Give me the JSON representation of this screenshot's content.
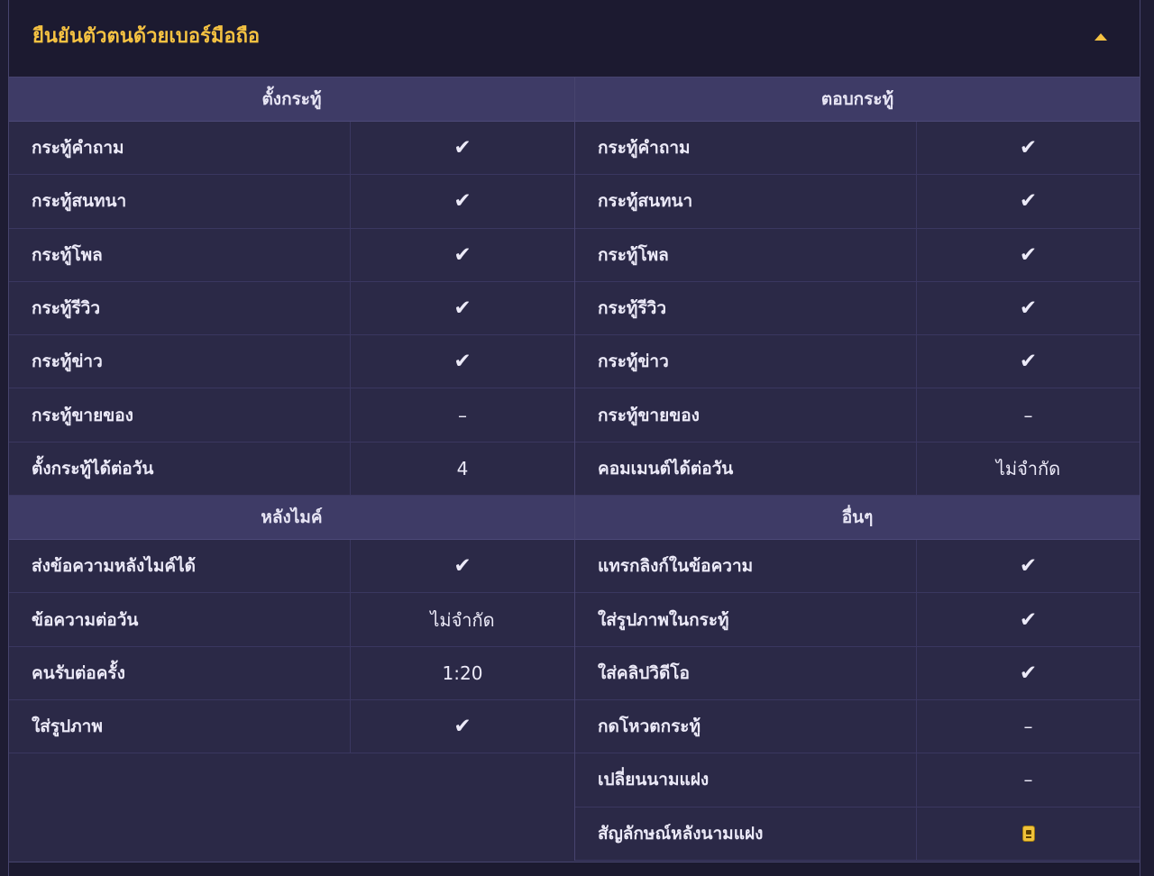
{
  "header": {
    "title": "ยืนยันตัวตนด้วยเบอร์มือถือ",
    "collapse_icon": "chevron-up-icon"
  },
  "colors": {
    "accent": "#f5c242",
    "panel_bg": "#2b2947",
    "section_header_bg": "#3e3b66"
  },
  "left": {
    "sections": [
      {
        "title": "ตั้งกระทู้",
        "rows": [
          {
            "label": "กระทู้คำถาม",
            "value": "✔"
          },
          {
            "label": "กระทู้สนทนา",
            "value": "✔"
          },
          {
            "label": "กระทู้โพล",
            "value": "✔"
          },
          {
            "label": "กระทู้รีวิว",
            "value": "✔"
          },
          {
            "label": "กระทู้ข่าว",
            "value": "✔"
          },
          {
            "label": "กระทู้ขายของ",
            "value": "–"
          },
          {
            "label": "ตั้งกระทู้ได้ต่อวัน",
            "value": "4"
          }
        ]
      },
      {
        "title": "หลังไมค์",
        "rows": [
          {
            "label": "ส่งข้อความหลังไมค์ได้",
            "value": "✔"
          },
          {
            "label": "ข้อความต่อวัน",
            "value": "ไม่จำกัด"
          },
          {
            "label": "คนรับต่อครั้ง",
            "value": "1:20"
          },
          {
            "label": "ใส่รูปภาพ",
            "value": "✔"
          }
        ]
      }
    ]
  },
  "right": {
    "sections": [
      {
        "title": "ตอบกระทู้",
        "rows": [
          {
            "label": "กระทู้คำถาม",
            "value": "✔"
          },
          {
            "label": "กระทู้สนทนา",
            "value": "✔"
          },
          {
            "label": "กระทู้โพล",
            "value": "✔"
          },
          {
            "label": "กระทู้รีวิว",
            "value": "✔"
          },
          {
            "label": "กระทู้ข่าว",
            "value": "✔"
          },
          {
            "label": "กระทู้ขายของ",
            "value": "–"
          },
          {
            "label": "คอมเมนต์ได้ต่อวัน",
            "value": "ไม่จำกัด"
          }
        ]
      },
      {
        "title": "อื่นๆ",
        "rows": [
          {
            "label": "แทรกลิงก์ในข้อความ",
            "value": "✔"
          },
          {
            "label": "ใส่รูปภาพในกระทู้",
            "value": "✔"
          },
          {
            "label": "ใส่คลิปวิดีโอ",
            "value": "✔"
          },
          {
            "label": "กดโหวตกระทู้",
            "value": "–"
          },
          {
            "label": "เปลี่ยนนามแฝง",
            "value": "–"
          },
          {
            "label": "สัญลักษณ์หลังนามแฝง",
            "value": "",
            "icon": "member-badge-icon"
          }
        ]
      }
    ]
  }
}
